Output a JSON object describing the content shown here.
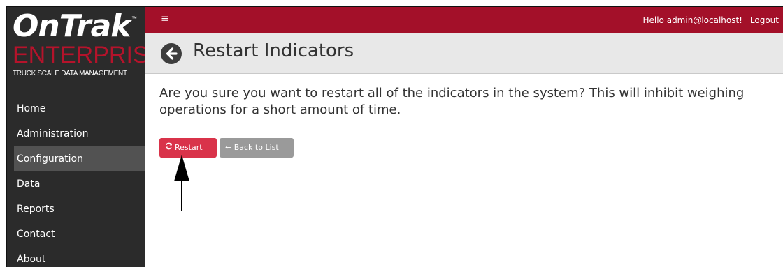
{
  "brand": {
    "name": "OnTrak",
    "trademark": "™",
    "edition": "ENTERPRISE",
    "tagline": "TRUCK SCALE DATA MANAGEMENT",
    "accent_color": "#a31029",
    "logo_red": "#b5132b"
  },
  "topbar": {
    "menu_icon": "hamburger-icon",
    "menu_glyph": "≡",
    "greeting": "Hello admin@localhost!",
    "logout_label": "Logout"
  },
  "sidebar": {
    "items": [
      {
        "label": "Home",
        "active": false
      },
      {
        "label": "Administration",
        "active": false
      },
      {
        "label": "Configuration",
        "active": true
      },
      {
        "label": "Data",
        "active": false
      },
      {
        "label": "Reports",
        "active": false
      },
      {
        "label": "Contact",
        "active": false
      },
      {
        "label": "About",
        "active": false
      }
    ]
  },
  "page": {
    "back_icon": "back-arrow-circle-icon",
    "title": "Restart Indicators",
    "message": "Are you sure you want to restart all of the indicators in the system? This will inhibit weighing operations for a short amount of time."
  },
  "actions": {
    "restart_icon": "refresh-icon",
    "restart_label": "Restart",
    "restart_color": "#d9334a",
    "back_icon": "left-arrow-icon",
    "back_label": "← Back to List",
    "back_color": "#9a9a9a"
  },
  "annotation": {
    "pointer_icon": "up-arrow-annotation-icon"
  }
}
